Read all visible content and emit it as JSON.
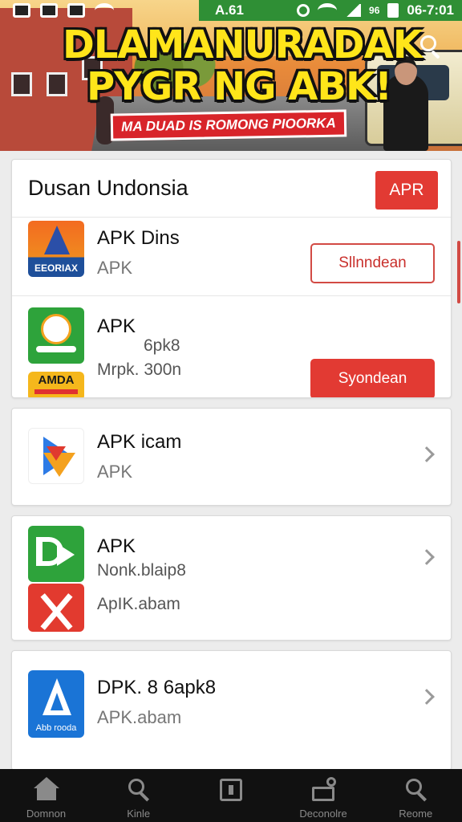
{
  "status_bar": {
    "time_left": "A.61",
    "battery_text": "96",
    "time_right": "06-7:01"
  },
  "banner": {
    "headline_line1": "DLAMANURADAK",
    "headline_line2": "PYGR NG ABK!",
    "strip_text": "MA DUAD IS ROMONG PIOORKA",
    "search_icon": "search-icon"
  },
  "featured_card": {
    "title": "Dusan Undonsia",
    "header_button": "APR",
    "apps": [
      {
        "name": "APK Dins",
        "sub": "APK",
        "icon_label": "EEORIAX",
        "button": "Sllnndean"
      },
      {
        "name": "APK",
        "meta": "6pk8",
        "sub": "Mrpk. 300n",
        "icon_label": "AMDA",
        "button": "Syondean"
      }
    ]
  },
  "list": [
    {
      "name": "APK icam",
      "sub": "APK"
    },
    {
      "name": "APK",
      "meta": "Nonk.blaip8",
      "sub": "ApIK.abam"
    },
    {
      "name": "DPK. 8 6apk8",
      "sub": "APK.abam",
      "icon_label": "Abb rooda"
    }
  ],
  "bottom_nav": [
    {
      "label": "Domnon",
      "icon": "home-icon"
    },
    {
      "label": "Kinle",
      "icon": "search-icon"
    },
    {
      "label": "",
      "icon": "box-icon"
    },
    {
      "label": "Deconolre",
      "icon": "tray-icon"
    },
    {
      "label": "Reome",
      "icon": "search-icon"
    }
  ],
  "colors": {
    "accent": "#e23a33",
    "nav_bg": "#111111",
    "status_green": "#2f8f35"
  }
}
